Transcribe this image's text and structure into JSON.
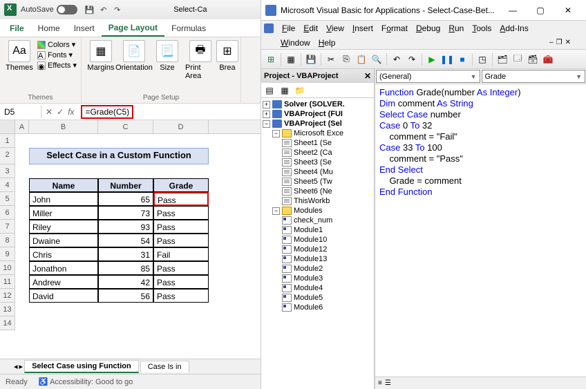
{
  "excel": {
    "titlebar": {
      "autosave": "AutoSave",
      "filename": "Select-Ca"
    },
    "tabs": {
      "file": "File",
      "home": "Home",
      "insert": "Insert",
      "pagelayout": "Page Layout",
      "formulas": "Formulas"
    },
    "ribbon": {
      "themes": {
        "label": "Themes",
        "btn": "Themes",
        "colors": "Colors",
        "fonts": "Fonts",
        "effects": "Effects"
      },
      "pagesetup": {
        "label": "Page Setup",
        "margins": "Margins",
        "orientation": "Orientation",
        "size": "Size",
        "printarea": "Print Area",
        "breaks": "Brea"
      }
    },
    "namebox": "D5",
    "formula": "=Grade(C5)",
    "cols": [
      "A",
      "B",
      "C",
      "D"
    ],
    "sheet_title": "Select Case in a Custom Function",
    "headers": {
      "name": "Name",
      "number": "Number",
      "grade": "Grade"
    },
    "rows": [
      {
        "name": "John",
        "number": "65",
        "grade": "Pass"
      },
      {
        "name": "Miller",
        "number": "73",
        "grade": "Pass"
      },
      {
        "name": "Riley",
        "number": "93",
        "grade": "Pass"
      },
      {
        "name": "Dwaine",
        "number": "54",
        "grade": "Pass"
      },
      {
        "name": "Chris",
        "number": "31",
        "grade": "Fail"
      },
      {
        "name": "Jonathon",
        "number": "85",
        "grade": "Pass"
      },
      {
        "name": "Andrew",
        "number": "42",
        "grade": "Pass"
      },
      {
        "name": "David",
        "number": "56",
        "grade": "Pass"
      }
    ],
    "sheets": {
      "active": "Select Case using Function",
      "next": "Case Is in"
    },
    "status": {
      "ready": "Ready",
      "access": "Accessibility: Good to go"
    }
  },
  "vba": {
    "title": "Microsoft Visual Basic for Applications - Select-Case-Bet...",
    "menus": {
      "file": "File",
      "edit": "Edit",
      "view": "View",
      "insert": "Insert",
      "format": "Format",
      "debug": "Debug",
      "run": "Run",
      "tools": "Tools",
      "addins": "Add-Ins",
      "window": "Window",
      "help": "Help"
    },
    "project_title": "Project - VBAProject",
    "tree": {
      "solver": "Solver (SOLVER.",
      "vbaproj1": "VBAProject (FUI",
      "vbaproj2": "VBAProject (Sel",
      "msexcel": "Microsoft Exce",
      "sheets": [
        "Sheet1 (Se",
        "Sheet2 (Ca",
        "Sheet3 (Se",
        "Sheet4 (Mu",
        "Sheet5 (Tw",
        "Sheet6 (Ne"
      ],
      "thiswb": "ThisWorkb",
      "modules_label": "Modules",
      "modules": [
        "check_num",
        "Module1",
        "Module10",
        "Module12",
        "Module13",
        "Module2",
        "Module3",
        "Module4",
        "Module5",
        "Module6"
      ]
    },
    "dd1": "(General)",
    "dd2": "Grade",
    "code": {
      "l1a": "Function",
      "l1b": " Grade(number ",
      "l1c": "As Integer",
      "l1d": ")",
      "l2a": "Dim",
      "l2b": " comment ",
      "l2c": "As String",
      "l3a": "Select Case",
      "l3b": " number",
      "l4a": "Case",
      "l4b": " 0 ",
      "l4c": "To",
      "l4d": " 32",
      "l5": "    comment = \"Fail\"",
      "l6a": "Case",
      "l6b": " 33 ",
      "l6c": "To",
      "l6d": " 100",
      "l7": "    comment = \"Pass\"",
      "l8": "End Select",
      "l9": "    Grade = comment",
      "l10": "End Function"
    }
  }
}
